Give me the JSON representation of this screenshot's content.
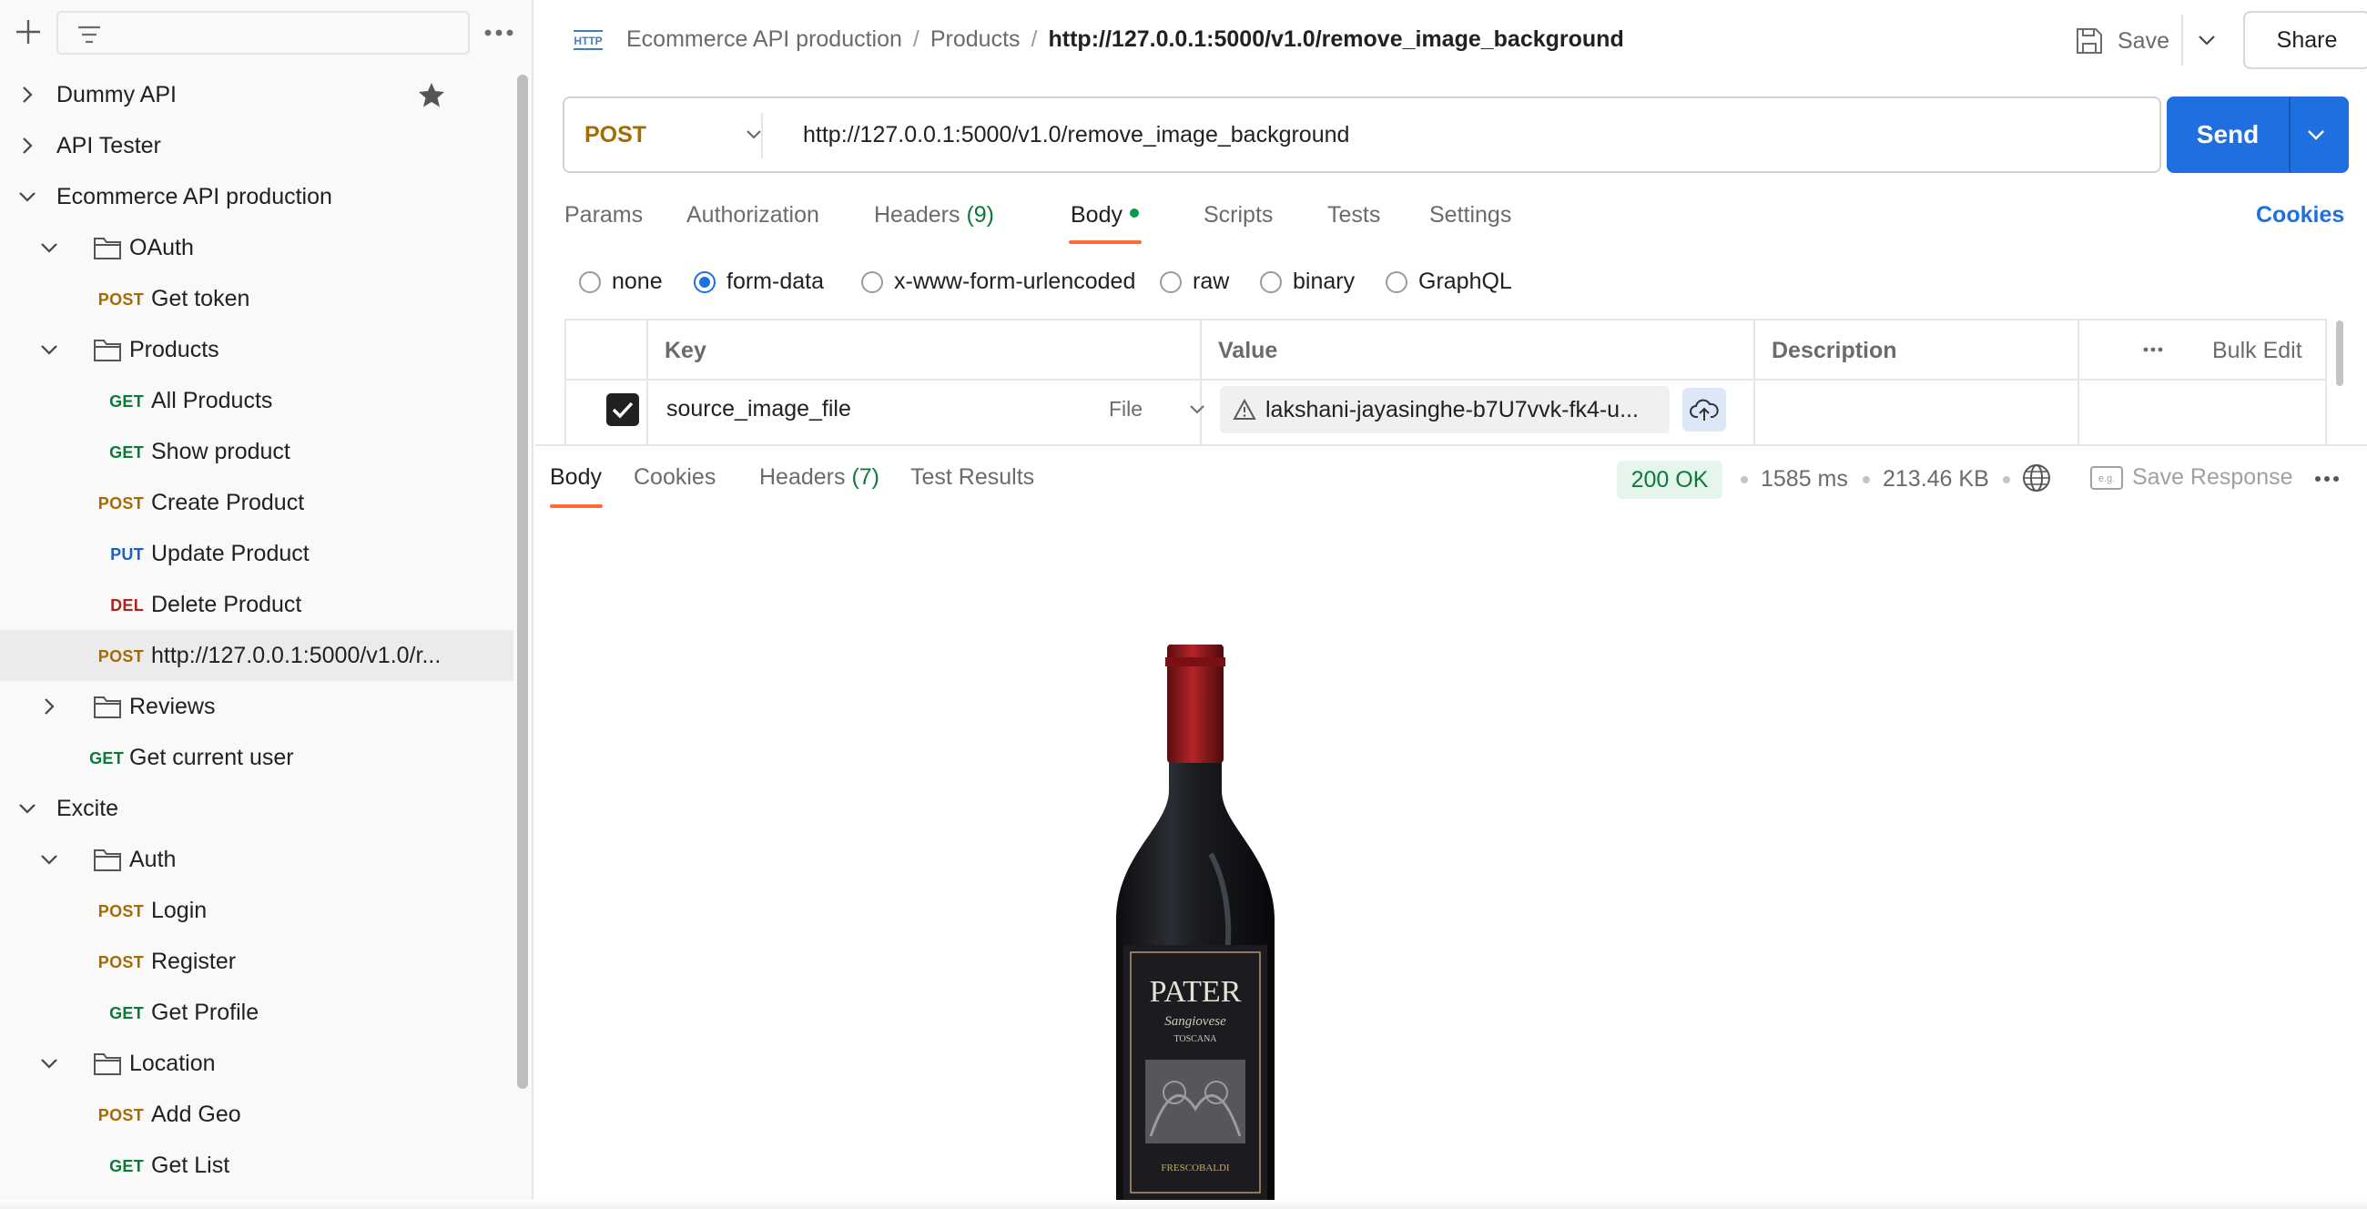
{
  "sidebar": {
    "filter_placeholder": "",
    "tree": [
      {
        "type": "collection",
        "label": "Dummy API",
        "expanded": false,
        "starred": true
      },
      {
        "type": "collection",
        "label": "API Tester",
        "expanded": false
      },
      {
        "type": "collection",
        "label": "Ecommerce API production",
        "expanded": true
      },
      {
        "type": "folder",
        "label": "OAuth",
        "expanded": true
      },
      {
        "type": "request",
        "method": "POST",
        "label": "Get token"
      },
      {
        "type": "folder",
        "label": "Products",
        "expanded": true
      },
      {
        "type": "request",
        "method": "GET",
        "label": "All Products"
      },
      {
        "type": "request",
        "method": "GET",
        "label": "Show product"
      },
      {
        "type": "request",
        "method": "POST",
        "label": "Create Product"
      },
      {
        "type": "request",
        "method": "PUT",
        "label": "Update Product"
      },
      {
        "type": "request",
        "method": "DEL",
        "label": "Delete Product"
      },
      {
        "type": "request",
        "method": "POST",
        "label": "http://127.0.0.1:5000/v1.0/r...",
        "active": true
      },
      {
        "type": "folder",
        "label": "Reviews",
        "expanded": false
      },
      {
        "type": "request",
        "method": "GET",
        "label": "Get current user"
      },
      {
        "type": "collection",
        "label": "Excite",
        "expanded": true
      },
      {
        "type": "folder",
        "label": "Auth",
        "expanded": true
      },
      {
        "type": "request",
        "method": "POST",
        "label": "Login"
      },
      {
        "type": "request",
        "method": "POST",
        "label": "Register"
      },
      {
        "type": "request",
        "method": "GET",
        "label": "Get Profile"
      },
      {
        "type": "folder",
        "label": "Location",
        "expanded": true
      },
      {
        "type": "request",
        "method": "POST",
        "label": "Add Geo"
      },
      {
        "type": "request",
        "method": "GET",
        "label": "Get List"
      }
    ]
  },
  "header": {
    "breadcrumb": [
      "Ecommerce API production",
      "Products",
      "http://127.0.0.1:5000/v1.0/remove_image_background"
    ],
    "save_label": "Save",
    "share_label": "Share"
  },
  "request": {
    "method": "POST",
    "url": "http://127.0.0.1:5000/v1.0/remove_image_background",
    "send_label": "Send",
    "tabs": [
      {
        "label": "Params"
      },
      {
        "label": "Authorization"
      },
      {
        "label": "Headers",
        "count": "(9)"
      },
      {
        "label": "Body",
        "active": true
      },
      {
        "label": "Scripts"
      },
      {
        "label": "Tests"
      },
      {
        "label": "Settings"
      }
    ],
    "cookies_label": "Cookies",
    "body_types": [
      "none",
      "form-data",
      "x-www-form-urlencoded",
      "raw",
      "binary",
      "GraphQL"
    ],
    "body_type_selected": "form-data",
    "table": {
      "headers": {
        "key": "Key",
        "value": "Value",
        "description": "Description",
        "bulk_edit": "Bulk Edit"
      },
      "rows": [
        {
          "checked": true,
          "key": "source_image_file",
          "type": "File",
          "value": "lakshani-jayasinghe-b7U7vvk-fk4-u...",
          "description": ""
        }
      ]
    }
  },
  "response": {
    "tabs": [
      {
        "label": "Body",
        "active": true
      },
      {
        "label": "Cookies"
      },
      {
        "label": "Headers",
        "count": "(7)"
      },
      {
        "label": "Test Results"
      }
    ],
    "status": "200 OK",
    "time": "1585 ms",
    "size": "213.46 KB",
    "save_response_label": "Save Response",
    "image_alt_text": [
      "PATER",
      "Sangiovese",
      "TOSCANA",
      "FRESCOBALDI"
    ]
  },
  "colors": {
    "accent": "#1f6fe0",
    "tab_indicator": "#ff6c37",
    "get": "#0b7a3b",
    "post": "#a46c00",
    "put": "#1d5fc2",
    "del": "#a9271e"
  }
}
